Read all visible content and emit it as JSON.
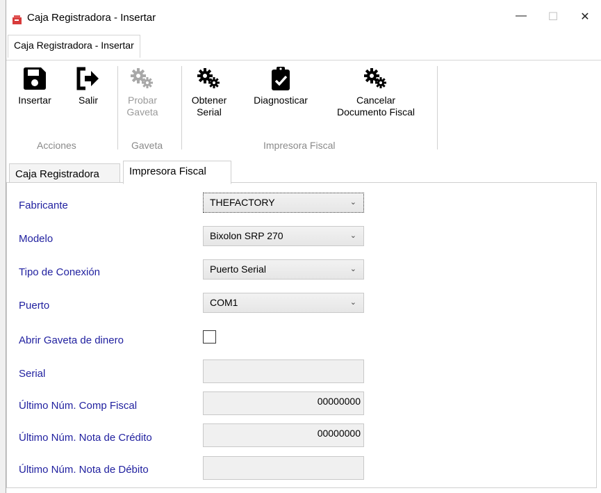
{
  "window": {
    "title": "Caja Registradora - Insertar",
    "minimize": "—",
    "maximize": "☐",
    "close": "✕"
  },
  "ribbon": {
    "tab": "Caja Registradora - Insertar",
    "buttons": {
      "insertar": "Insertar",
      "salir": "Salir",
      "probar_1": "Probar",
      "probar_2": "Gaveta",
      "obtener_1": "Obtener",
      "obtener_2": "Serial",
      "diagnosticar": "Diagnosticar",
      "cancelar_1": "Cancelar",
      "cancelar_2": "Documento Fiscal"
    },
    "groups": {
      "acciones": "Acciones",
      "gaveta": "Gaveta",
      "impresora": "Impresora Fiscal"
    }
  },
  "tabs": {
    "caja": "Caja Registradora",
    "impresora": "Impresora Fiscal"
  },
  "form": {
    "fabricante_label": "Fabricante",
    "fabricante_value": "THEFACTORY",
    "modelo_label": "Modelo",
    "modelo_value": "Bixolon SRP 270",
    "conexion_label": "Tipo de Conexión",
    "conexion_value": "Puerto Serial",
    "puerto_label": "Puerto",
    "puerto_value": "COM1",
    "gaveta_label": "Abrir Gaveta de dinero",
    "gaveta_checked": false,
    "serial_label": "Serial",
    "serial_value": "",
    "comp_label": "Último Núm. Comp Fiscal",
    "comp_value": "00000000",
    "nc_label": "Último Núm. Nota de Crédito",
    "nc_value": "00000000",
    "nd_label": "Último Núm. Nota de Débito",
    "nd_value": ""
  },
  "dropdown_arrow": "⌄"
}
